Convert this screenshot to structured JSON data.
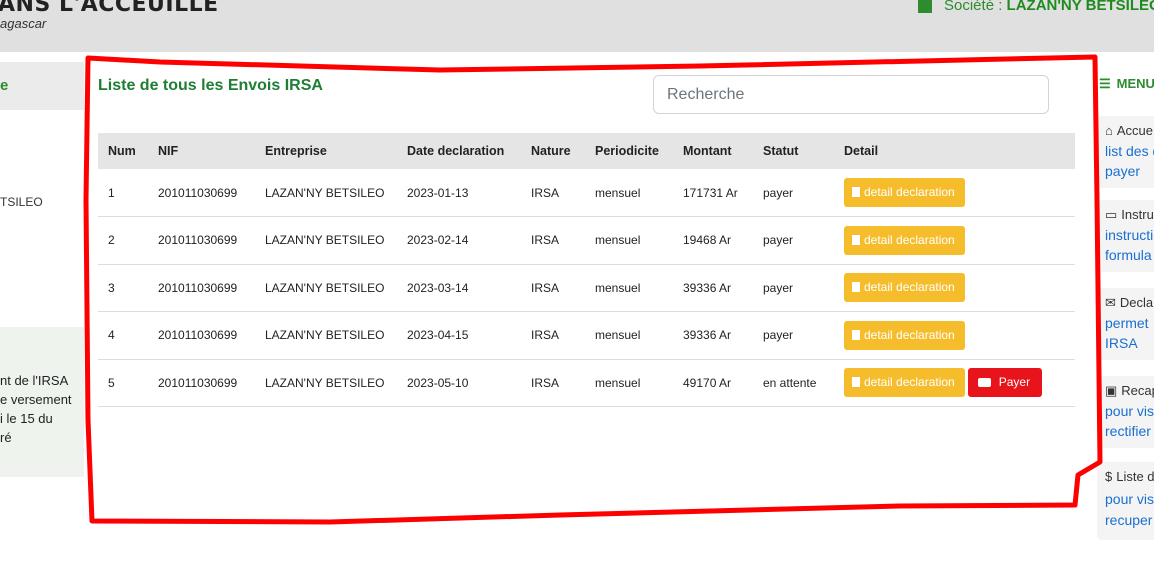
{
  "header": {
    "title": "ANS L'ACCEUILLE",
    "subtitle": "agascar",
    "societe_label": "Société : ",
    "societe_name": "LAZAN'NY BETSILEO"
  },
  "left_panel": {
    "green_text": "e",
    "company_fragment": "TSILEO",
    "info_lines": [
      "nt de l'IRSA",
      "e versement",
      "i le 15 du",
      "ré"
    ]
  },
  "main": {
    "heading": "Liste de tous les Envois IRSA",
    "search_placeholder": "Recherche",
    "table": {
      "headers": [
        "Num",
        "NIF",
        "Entreprise",
        "Date declaration",
        "Nature",
        "Periodicite",
        "Montant",
        "Statut",
        "Detail"
      ],
      "rows": [
        {
          "num": "1",
          "nif": "201011030699",
          "entreprise": "LAZAN'NY BETSILEO",
          "date": "2023-01-13",
          "nature": "IRSA",
          "periodicite": "mensuel",
          "montant": "171731 Ar",
          "statut": "payer"
        },
        {
          "num": "2",
          "nif": "201011030699",
          "entreprise": "LAZAN'NY BETSILEO",
          "date": "2023-02-14",
          "nature": "IRSA",
          "periodicite": "mensuel",
          "montant": "19468 Ar",
          "statut": "payer"
        },
        {
          "num": "3",
          "nif": "201011030699",
          "entreprise": "LAZAN'NY BETSILEO",
          "date": "2023-03-14",
          "nature": "IRSA",
          "periodicite": "mensuel",
          "montant": "39336 Ar",
          "statut": "payer"
        },
        {
          "num": "4",
          "nif": "201011030699",
          "entreprise": "LAZAN'NY BETSILEO",
          "date": "2023-04-15",
          "nature": "IRSA",
          "periodicite": "mensuel",
          "montant": "39336 Ar",
          "statut": "payer"
        },
        {
          "num": "5",
          "nif": "201011030699",
          "entreprise": "LAZAN'NY BETSILEO",
          "date": "2023-05-10",
          "nature": "IRSA",
          "periodicite": "mensuel",
          "montant": "49170 Ar",
          "statut": "en attente"
        }
      ],
      "detail_button_label": "detail declaration",
      "pay_button_label": "Payer"
    }
  },
  "right_menu": {
    "menu_label": "MENU",
    "items": [
      {
        "icon": "home-icon",
        "title": "Accue",
        "lines": [
          "list des d",
          "payer"
        ]
      },
      {
        "icon": "monitor-icon",
        "title": "Instru",
        "lines": [
          "instructi",
          "formula"
        ]
      },
      {
        "icon": "envelope-icon",
        "title": "Declar",
        "lines": [
          "permet",
          "IRSA"
        ]
      },
      {
        "icon": "archive-icon",
        "title": "Recap",
        "lines": [
          "pour vis",
          "rectifier"
        ]
      },
      {
        "icon": "dollar-icon",
        "title": "Liste d",
        "lines": [
          "pour vis",
          "recuper"
        ]
      }
    ]
  },
  "colors": {
    "accent_green": "#2e8b2e",
    "detail_button": "#f5bd2b",
    "pay_button": "#e8141b",
    "link_blue": "#1a6fd1",
    "annotation_red": "#ff0000"
  }
}
